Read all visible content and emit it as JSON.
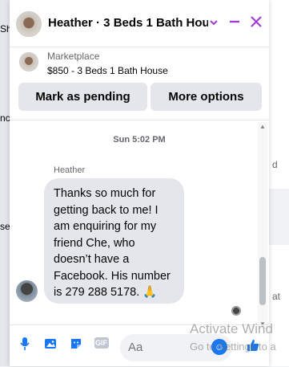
{
  "background": {
    "left_chip_top": "Sh",
    "left_text_1": "nc",
    "left_text_2": "se",
    "right_text_1": "d",
    "right_text_2": "at"
  },
  "header": {
    "title": "Heather · 3 Beds 1 Bath Hou…",
    "chevron_icon": "chevron-down-icon",
    "minimize_icon": "minimize-icon",
    "close_icon": "close-icon"
  },
  "listing": {
    "label": "Marketplace",
    "price_title": "$850 - 3 Beds 1 Bath House"
  },
  "actions": {
    "mark_pending": "Mark as pending",
    "more_options": "More options"
  },
  "conversation": {
    "timestamp": "Sun 5:02 PM",
    "sender": "Heather",
    "message": "Thanks so much for getting back to me! I am enquiring for my friend Che, who doesn’t have a Facebook. His number is 279 288 5178. 🙏"
  },
  "composer": {
    "placeholder": "Aa",
    "icons": [
      "microphone-icon",
      "image-icon",
      "sticker-icon",
      "gif-icon",
      "emoji-icon",
      "like-icon"
    ],
    "gif_label": "GIF"
  },
  "watermark": {
    "line1": "Activate Wind",
    "line2": "Go to Settings to a"
  },
  "colors": {
    "accent": "#a23cd3",
    "messenger_blue": "#1877f2",
    "bubble": "#e4e6eb"
  }
}
